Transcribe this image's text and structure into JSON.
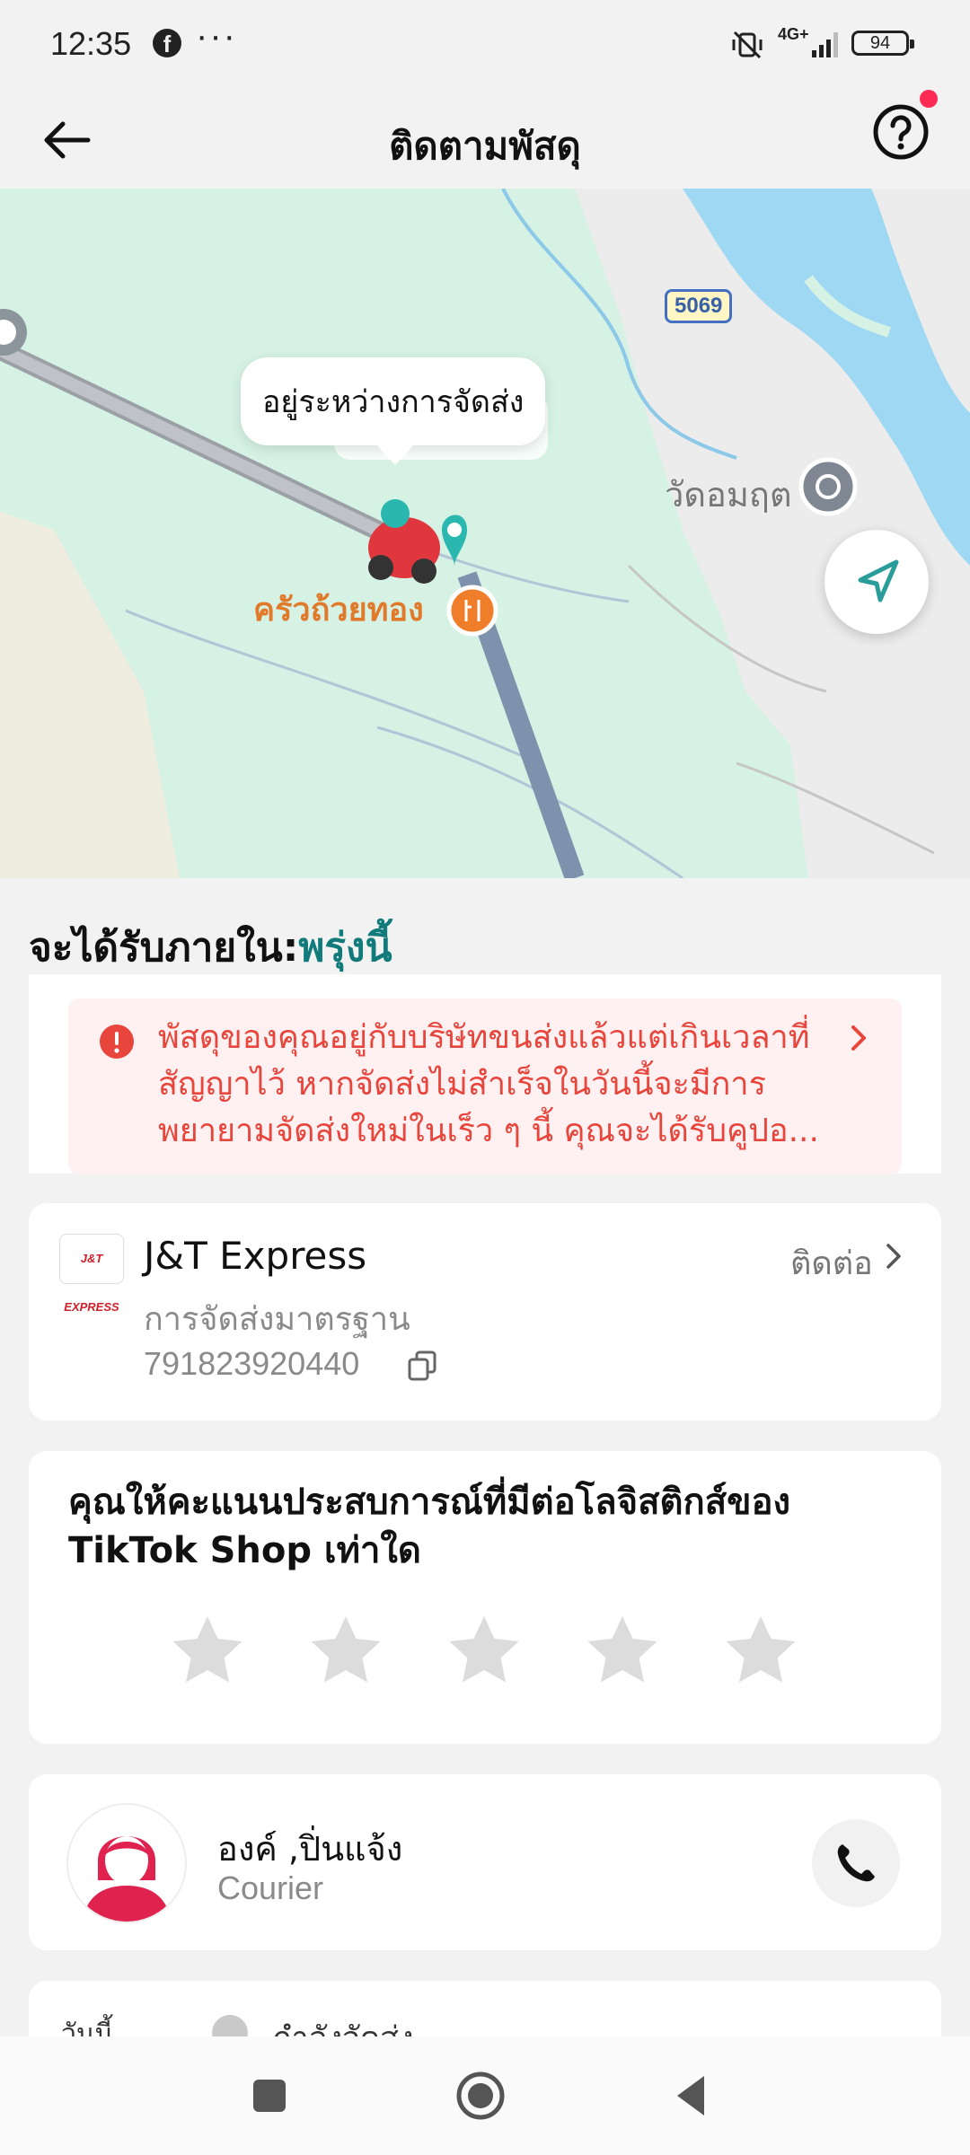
{
  "status_bar": {
    "time": "12:35",
    "notification_app": "f",
    "more_dots": "···",
    "network": "4G+",
    "battery": "94"
  },
  "header": {
    "title": "ติดตามพัสดุ"
  },
  "map": {
    "status_bubble": "อยู่ระหว่างการจัดส่ง",
    "restaurant_label": "ครัวถ้วยทอง",
    "temple_label": "วัดอมฤต",
    "road_number": "5069"
  },
  "delivery": {
    "eta_label": "จะได้รับภายใน:",
    "eta_value": "พรุ่งนี้",
    "alert_text": "พัสดุของคุณอยู่กับบริษัทขนส่งแล้วแต่เกินเวลาที่สัญญาไว้ หากจัดส่งไม่สำเร็จในวันนี้จะมีการพยายามจัดส่งใหม่ในเร็ว ๆ นี้ คุณจะได้รับคูปอ..."
  },
  "carrier": {
    "logo_text": "J&T EXPRESS",
    "name": "J&T Express",
    "service": "การจัดส่งมาตรฐาน",
    "tracking_number": "791823920440",
    "contact_label": "ติดต่อ"
  },
  "rating": {
    "question": "คุณให้คะแนนประสบการณ์ที่มีต่อโลจิสติกส์ของ TikTok Shop เท่าใด",
    "stars_total": 5,
    "stars_selected": 0
  },
  "courier": {
    "name": "องค์ ,ปิ่นแจ้ง",
    "role": "Courier"
  },
  "timeline": {
    "date": "วันนี้",
    "status": "กำลังจัดส่ง"
  },
  "colors": {
    "accent_teal": "#117a7a",
    "alert_red": "#e8453c",
    "alert_bg": "#fff1f1",
    "notification_dot": "#fe2c55",
    "map_green": "#d6f2e4",
    "river_blue": "#9fd8f2"
  },
  "icons": {
    "back": "arrow-left-icon",
    "help": "question-circle-icon",
    "locate": "navigation-arrow-icon",
    "alert": "exclamation-circle-icon",
    "copy": "copy-icon",
    "call": "phone-icon",
    "star": "star-icon"
  }
}
